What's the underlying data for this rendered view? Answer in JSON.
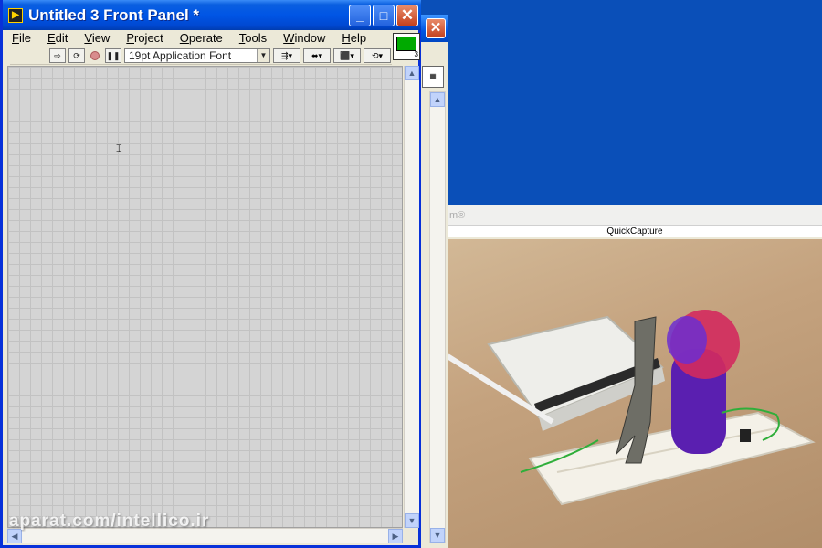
{
  "window": {
    "title": "Untitled 3 Front Panel *",
    "minimize": "_",
    "maximize": "□",
    "close": "✕"
  },
  "menu": [
    {
      "label": "File"
    },
    {
      "label": "Edit"
    },
    {
      "label": "View"
    },
    {
      "label": "Project"
    },
    {
      "label": "Operate"
    },
    {
      "label": "Tools"
    },
    {
      "label": "Window"
    },
    {
      "label": "Help"
    }
  ],
  "toolbar": {
    "run": "⇨",
    "run_continuous": "⟳",
    "abort": "",
    "pause": "❚❚",
    "font": "19pt Application Font",
    "align": "⇶▾",
    "distribute": "⬌▾",
    "resize": "⬛▾",
    "reorder": "⟲▾"
  },
  "panel": {
    "cursor": "⌶"
  },
  "back_window": {
    "close": "✕"
  },
  "quickcapture": {
    "title_fragment": "m®",
    "label": "QuickCapture"
  },
  "scroll": {
    "up": "▲",
    "down": "▼",
    "left": "◀",
    "right": "▶"
  },
  "watermark": "aparat.com/intellico.ir",
  "colors": {
    "desktop": "#0a4fb8",
    "titlebar": "#0055e5",
    "close_button": "#c4401e",
    "panel_bg": "#d4d4d4"
  }
}
